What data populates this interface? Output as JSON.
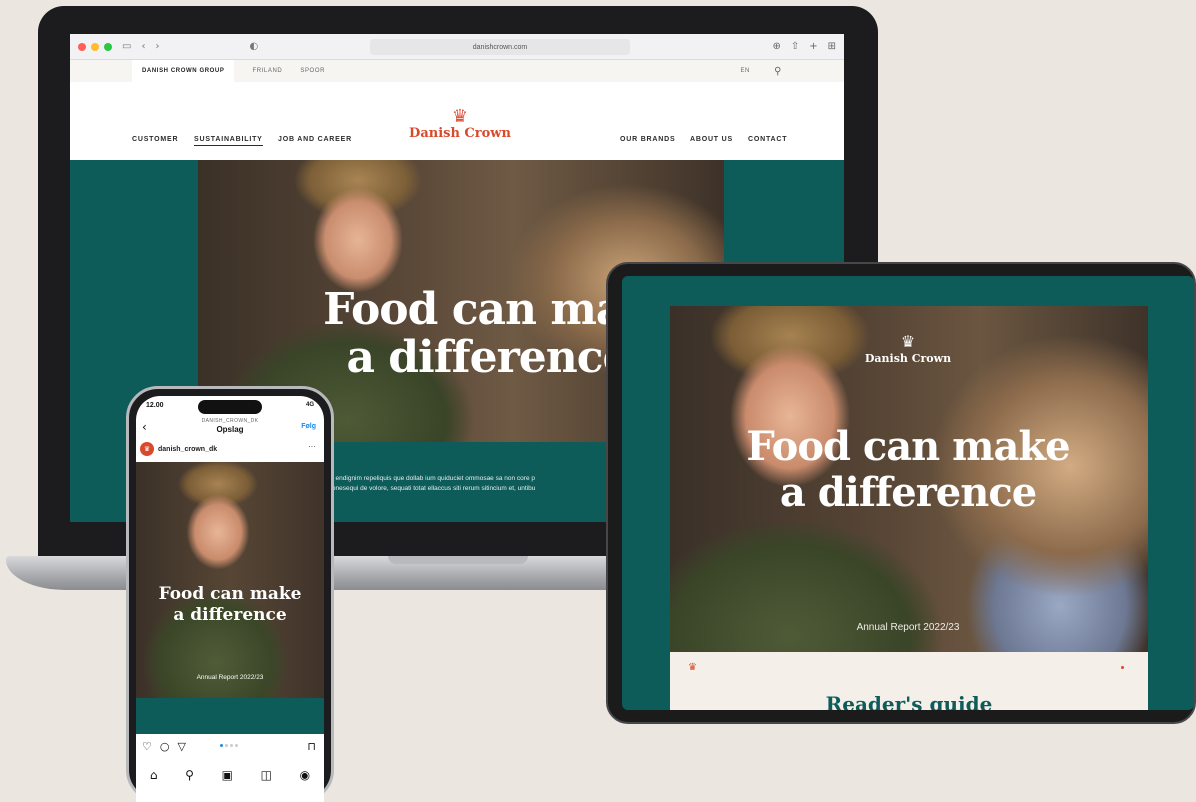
{
  "laptop": {
    "browser": {
      "url": "danishcrown.com",
      "icons": [
        "sidebar-icon",
        "back-icon",
        "forward-icon",
        "shield-icon",
        "reload-icon",
        "download-icon",
        "share-icon",
        "new-tab-icon",
        "tabs-icon"
      ]
    },
    "topbar": {
      "group_label": "DANISH CROWN GROUP",
      "links": [
        "FRILAND",
        "SPOOR"
      ],
      "language": "EN"
    },
    "nav_left": [
      "CUSTOMER",
      "SUSTAINABILITY",
      "JOB AND CAREER"
    ],
    "nav_right": [
      "OUR BRANDS",
      "ABOUT US",
      "CONTACT"
    ],
    "brand": "Danish Crown",
    "hero_title_line1": "Food can mak",
    "hero_title_line2": "a difference",
    "hero_text_line1": "nieni endignim repeliquis que dollab ium quiduciet ommosae sa non core p",
    "hero_text_line2": "se conesequi de volore, sequati totat ellaccus siti rerum sitincium et, untibu"
  },
  "tablet": {
    "brand": "Danish Crown",
    "title_line1": "Food can make",
    "title_line2": "a difference",
    "subtitle": "Annual Report 2022/23",
    "panel_heading": "Reader's guide"
  },
  "phone": {
    "time": "12.00",
    "signal": "4G",
    "account": "DANISH_CROWN_DK",
    "heading": "Opslag",
    "follow": "Følg",
    "username": "danish_crown_dk",
    "title_line1": "Food can make",
    "title_line2": "a difference",
    "subtitle": "Annual Report 2022/23",
    "post_actions": [
      "heart-icon",
      "comment-icon",
      "send-icon",
      "bookmark-icon"
    ],
    "tabbar": [
      "home-icon",
      "search-icon",
      "reels-icon",
      "shop-icon",
      "profile-icon"
    ]
  },
  "colors": {
    "background": "#ece6e0",
    "teal": "#0e5c5a",
    "brand_red": "#d94a2c",
    "link_blue": "#1a8cf0"
  }
}
